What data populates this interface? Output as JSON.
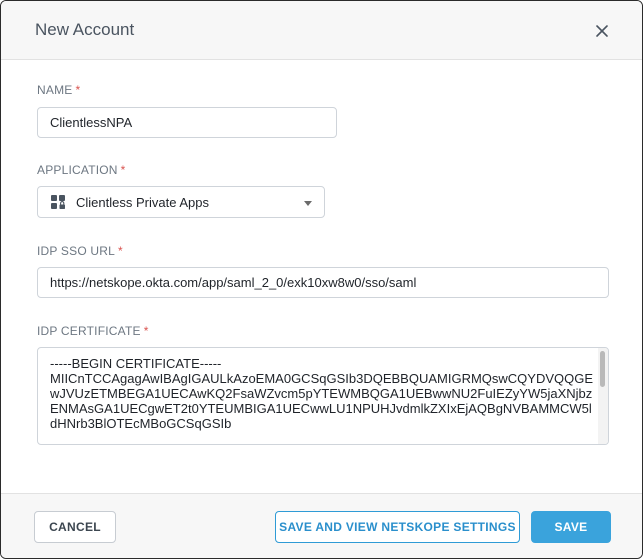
{
  "dialog": {
    "title": "New Account",
    "close_icon": "close-icon"
  },
  "fields": {
    "name": {
      "label": "NAME",
      "required_mark": "*",
      "value": "ClientlessNPA"
    },
    "application": {
      "label": "APPLICATION",
      "required_mark": "*",
      "value": "Clientless Private Apps",
      "icon": "private-apps-icon"
    },
    "idp_sso_url": {
      "label": "IDP SSO URL",
      "required_mark": "*",
      "value": "https://netskope.okta.com/app/saml_2_0/exk10xw8w0/sso/saml"
    },
    "idp_certificate": {
      "label": "IDP CERTIFICATE",
      "required_mark": "*",
      "value": "-----BEGIN CERTIFICATE-----\nMIICnTCCAgagAwIBAgIGAULkAzoEMA0GCSqGSIb3DQEBBQUAMIGRMQswCQYDVQQGEwJVUzETMBEGA1UECAwKQ2FsaWZvcm5pYTEWMBQGA1UEBwwNU2FuIEZyYW5jaXNjbzENMAsGA1UECgwET2t0YTEUMBIGA1UECwwLU1NPUHJvdmlkZXIxEjAQBgNVBAMMCW5ldHNrb3BlOTEcMBoGCSqGSIb"
    }
  },
  "footer": {
    "cancel_label": "CANCEL",
    "save_view_label": "SAVE AND VIEW NETSKOPE SETTINGS",
    "save_label": "SAVE"
  },
  "colors": {
    "accent": "#3aa3dc",
    "required": "#d9534f",
    "header_bg": "#f7f7f7"
  }
}
